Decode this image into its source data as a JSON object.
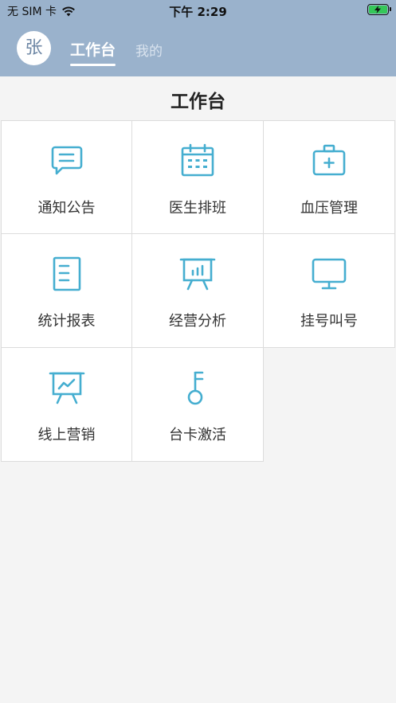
{
  "status_bar": {
    "carrier": "无 SIM 卡",
    "time": "下午 2:29"
  },
  "nav": {
    "avatar_text": "张",
    "tabs": [
      {
        "label": "工作台"
      },
      {
        "label": "我的"
      }
    ]
  },
  "page": {
    "title": "工作台"
  },
  "grid": [
    {
      "label": "通知公告",
      "icon": "chat-icon"
    },
    {
      "label": "医生排班",
      "icon": "calendar-icon"
    },
    {
      "label": "血压管理",
      "icon": "medical-kit-icon"
    },
    {
      "label": "统计报表",
      "icon": "document-icon"
    },
    {
      "label": "经营分析",
      "icon": "presentation-chart-icon"
    },
    {
      "label": "挂号叫号",
      "icon": "monitor-icon"
    },
    {
      "label": "线上营销",
      "icon": "presentation-trend-icon"
    },
    {
      "label": "台卡激活",
      "icon": "key-icon"
    }
  ],
  "colors": {
    "header": "#9ab2cc",
    "icon": "#45aed0",
    "background": "#f4f4f4"
  }
}
